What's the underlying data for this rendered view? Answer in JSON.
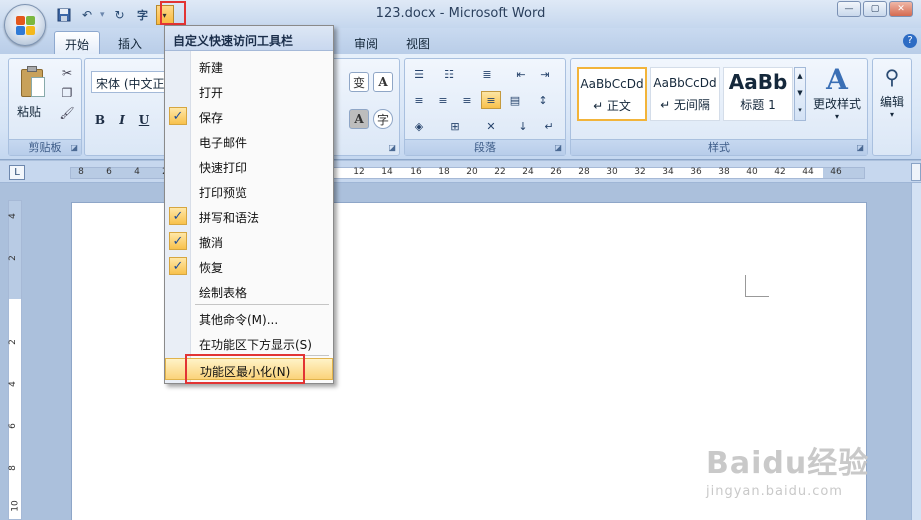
{
  "window": {
    "title": "123.docx - Microsoft Word"
  },
  "tabs": [
    {
      "label": "开始",
      "active": true
    },
    {
      "label": "插入"
    },
    {
      "label": "审阅"
    },
    {
      "label": "视图"
    }
  ],
  "ribbon": {
    "clipboard": {
      "paste_label": "粘贴",
      "group_label": "剪贴板"
    },
    "font": {
      "font_name": "宋体 (中文正文",
      "bold": "B",
      "italic": "I",
      "underline": "U"
    },
    "paragraph": {
      "group_label": "段落"
    },
    "styles": {
      "cards": [
        {
          "sample": "AaBbCcDd",
          "name": "↵ 正文"
        },
        {
          "sample": "AaBbCcDd",
          "name": "↵ 无间隔"
        },
        {
          "sample": "AaBb",
          "name": "标题 1"
        }
      ],
      "change_styles_label": "更改样式",
      "group_label": "样式"
    },
    "editing": {
      "label": "编辑"
    }
  },
  "menu": {
    "header": "自定义快速访问工具栏",
    "items": [
      {
        "label": "新建",
        "checked": false
      },
      {
        "label": "打开",
        "checked": false
      },
      {
        "label": "保存",
        "checked": true
      },
      {
        "label": "电子邮件",
        "checked": false
      },
      {
        "label": "快速打印",
        "checked": false
      },
      {
        "label": "打印预览",
        "checked": false
      },
      {
        "label": "拼写和语法",
        "checked": true
      },
      {
        "label": "撤消",
        "checked": true
      },
      {
        "label": "恢复",
        "checked": true
      },
      {
        "label": "绘制表格",
        "checked": false
      }
    ],
    "more_commands": "其他命令(M)...",
    "show_below": "在功能区下方显示(S)",
    "minimize_ribbon": "功能区最小化(N)"
  },
  "ruler": {
    "h_ticks": [
      "8",
      "6",
      "4",
      "2",
      "12",
      "14",
      "16",
      "18",
      "20",
      "22",
      "24",
      "26",
      "28",
      "30",
      "32",
      "34",
      "36",
      "38",
      "40",
      "42",
      "44",
      "46"
    ],
    "v_ticks": [
      "4",
      "2",
      "2",
      "4",
      "6",
      "8",
      "10"
    ]
  },
  "watermark": {
    "main": "Baidu经验",
    "sub": "jingyan.baidu.com"
  },
  "colors": {
    "highlight": "#f8c14c",
    "annotation_red": "#e23434"
  }
}
